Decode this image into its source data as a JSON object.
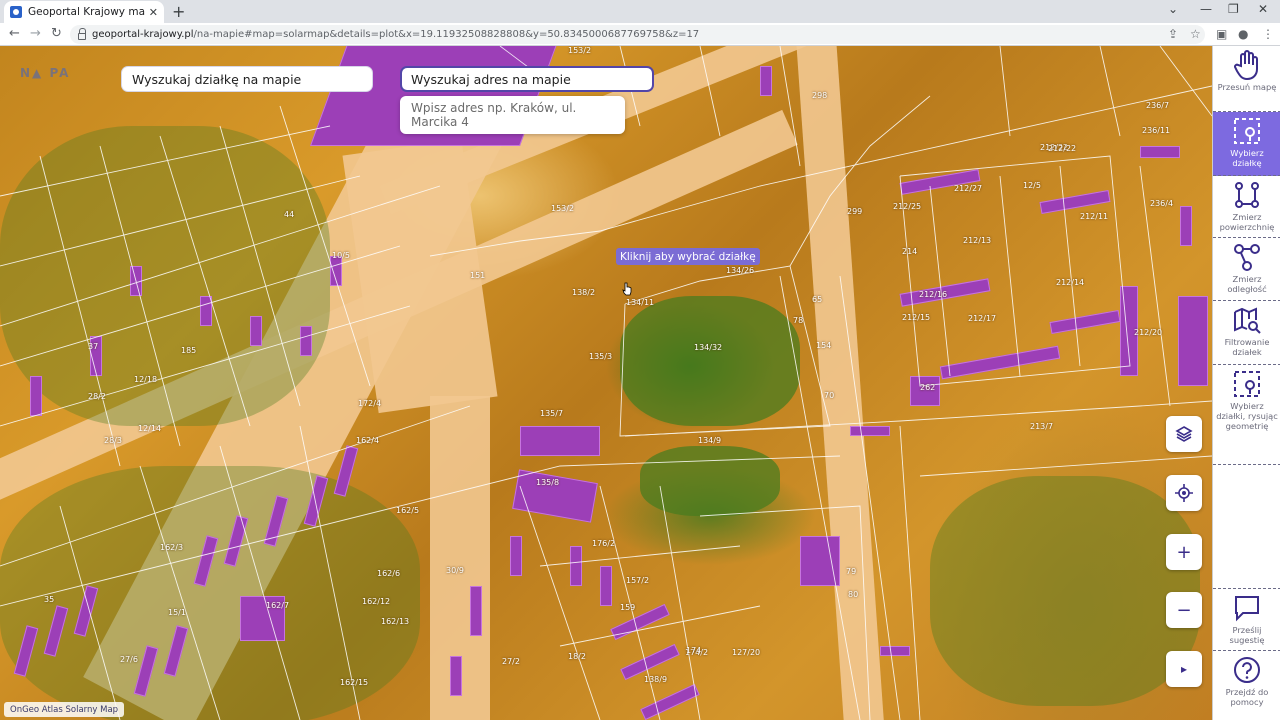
{
  "browser": {
    "tab_title": "Geoportal Krajowy mapy i inform",
    "tab_close": "✕",
    "new_tab": "+",
    "url_host": "geoportal-krajowy.pl",
    "url_path": "/na-mapie#map=solarmap&details=plot&x=19.11932508828808&y=50.8345000687769758&z=17",
    "controls": {
      "back": "←",
      "forward": "→",
      "reload": "↻",
      "share": "⇪",
      "star": "☆",
      "sidepanel": "▣",
      "profile": "●",
      "menu": "⋮",
      "dropdown": "⌄",
      "minimize": "—",
      "restore": "❐",
      "close": "✕"
    }
  },
  "search": {
    "plot_label": "Wyszukaj działkę na mapie",
    "address_label": "Wyszukaj adres na mapie",
    "address_suggestion": "Wpisz adres np. Kraków, ul. Marcika 4"
  },
  "map": {
    "tooltip": "Kliknij aby wybrać działkę",
    "attribution": "OnGeo Atlas Solarny Map",
    "controls": [
      "layers-button",
      "locate-button",
      "zoom-in-button",
      "zoom-out-button",
      "expand-button"
    ],
    "control_glyphs": {
      "layers": "◈",
      "locate": "⊙",
      "zoom_in": "+",
      "zoom_out": "−",
      "expand": "▸"
    },
    "logo_text": "N▲ PA",
    "plot_labels": [
      "153/2",
      "153/2",
      "138/2",
      "134/32",
      "134/26",
      "134/11",
      "135/3",
      "135/7",
      "135/8",
      "134/9",
      "212/27",
      "212/25",
      "212/13",
      "212/16",
      "212/15",
      "212/17",
      "212/20",
      "212/14",
      "212/22",
      "212/11",
      "236/4",
      "236/7",
      "236/11",
      "262",
      "214",
      "213/7",
      "162/4",
      "162/3",
      "162/6",
      "162/7",
      "162/5",
      "162/13",
      "162/12",
      "162/15",
      "172/4",
      "174/2",
      "176/2",
      "157/2",
      "159",
      "127/20",
      "138/9",
      "174",
      "18/2",
      "27/2",
      "27/6",
      "30/9",
      "28/3",
      "28/2",
      "12/14",
      "12/18",
      "185",
      "37",
      "44",
      "10/5",
      "15/1",
      "35",
      "65",
      "78",
      "80",
      "70",
      "79",
      "154",
      "151",
      "299",
      "298",
      "212/22",
      "12/5"
    ]
  },
  "tools": [
    {
      "label": "Przesuń mapę",
      "icon": "hand-icon"
    },
    {
      "label": "Wybierz działkę",
      "icon": "select-plot-icon"
    },
    {
      "label": "Zmierz powierzchnię",
      "icon": "measure-area-icon"
    },
    {
      "label": "Zmierz odległość",
      "icon": "measure-distance-icon"
    },
    {
      "label": "Filtrowanie działek",
      "icon": "filter-map-icon"
    },
    {
      "label": "Wybierz działki, rysując geometrię",
      "icon": "draw-select-icon"
    },
    {
      "label": "Prześlij sugestię",
      "icon": "chat-icon"
    },
    {
      "label": "Przejdź do pomocy",
      "icon": "help-icon"
    }
  ],
  "active_tool": "Wybierz działkę",
  "colors": {
    "accent": "#7d6ae0",
    "accent_dark": "#3a2d8a",
    "building": "#9c3fb7"
  }
}
